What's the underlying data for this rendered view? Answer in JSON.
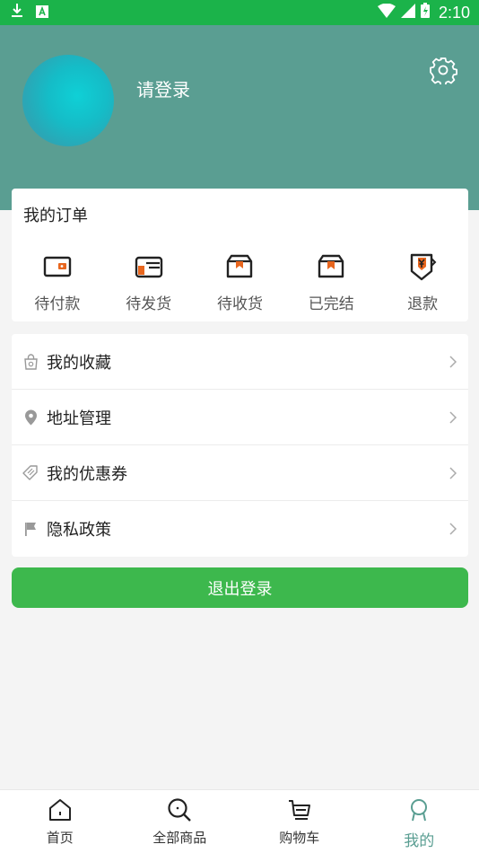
{
  "status_bar": {
    "time": "2:10"
  },
  "profile": {
    "login_prompt": "请登录"
  },
  "orders": {
    "title": "我的订单",
    "items": [
      {
        "label": "待付款",
        "icon": "wallet-icon"
      },
      {
        "label": "待发货",
        "icon": "card-icon"
      },
      {
        "label": "待收货",
        "icon": "box-icon"
      },
      {
        "label": "已完结",
        "icon": "box-done-icon"
      },
      {
        "label": "退款",
        "icon": "refund-icon"
      }
    ]
  },
  "menu": [
    {
      "label": "我的收藏",
      "icon": "favorites-bag-icon"
    },
    {
      "label": "地址管理",
      "icon": "location-pin-icon"
    },
    {
      "label": "我的优惠券",
      "icon": "coupon-icon"
    },
    {
      "label": "隐私政策",
      "icon": "flag-icon"
    }
  ],
  "logout_label": "退出登录",
  "tabs": [
    {
      "label": "首页",
      "icon": "home-icon",
      "active": false
    },
    {
      "label": "全部商品",
      "icon": "search-icon",
      "active": false
    },
    {
      "label": "购物车",
      "icon": "cart-icon",
      "active": false
    },
    {
      "label": "我的",
      "icon": "profile-icon",
      "active": true
    }
  ],
  "colors": {
    "status_bar": "#1bb34a",
    "header": "#5a9e92",
    "accent_orange": "#e8661e",
    "logout_button": "#3db84d",
    "active_tab": "#5a9e92"
  }
}
